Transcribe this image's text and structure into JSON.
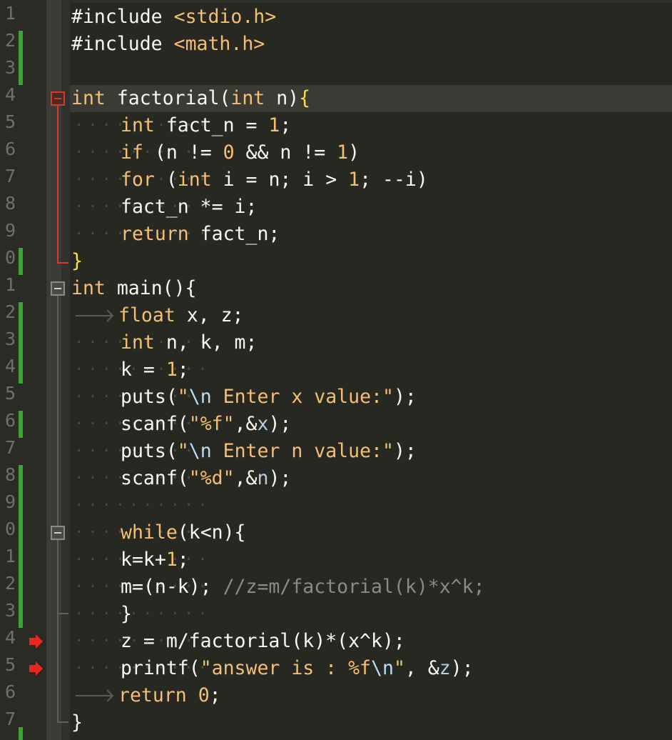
{
  "line_numbers": [
    "1",
    "2",
    "3",
    "4",
    "5",
    "6",
    "7",
    "8",
    "9",
    "0",
    "1",
    "2",
    "3",
    "4",
    "5",
    "6",
    "7",
    "8",
    "9",
    "0",
    "1",
    "2",
    "3",
    "4",
    "5",
    "6",
    "7"
  ],
  "colors": {
    "background": "#272822",
    "keyword": "#f4bf75",
    "comment": "#8b8b85",
    "bracket": "#f8e049",
    "git_modified": "#3f9f3a",
    "breakpoint": "#e8281e"
  },
  "code": {
    "l1": {
      "a": "#include",
      "b": " ",
      "c": "<stdio.h>"
    },
    "l2": {
      "a": "#include",
      "b": " ",
      "c": "<math.h>"
    },
    "l4": {
      "t1": "int",
      "s1": " factorial(",
      "t2": "int",
      "s2": " n)",
      "br": "{"
    },
    "l5": {
      "t1": "int",
      "s1": " fact_n = ",
      "n1": "1",
      "s2": ";"
    },
    "l6": {
      "k1": "if",
      "s1": " (n != ",
      "n1": "0",
      "s2": " && n != ",
      "n2": "1",
      "s3": ")"
    },
    "l7": {
      "k1": "for",
      "s1": " (",
      "t1": "int",
      "s2": " i = n; i > ",
      "n1": "1",
      "s3": "; --i)"
    },
    "l8": {
      "s1": "fact_n *= i;"
    },
    "l9": {
      "k1": "return",
      "s1": " fact_n;"
    },
    "l10": {
      "br": "}"
    },
    "l11": {
      "t1": "int",
      "s1": " main(){"
    },
    "l12": {
      "t1": "float",
      "s1": " x, z;"
    },
    "l13": {
      "t1": "int",
      "s1": " n, k, m;"
    },
    "l14": {
      "s1": "k = ",
      "n1": "1",
      "s2": ";"
    },
    "l15": {
      "s1": "puts(",
      "q1": "\"",
      "e1": "\\n",
      "q2": " Enter x value:\"",
      "s2": ");"
    },
    "l16": {
      "s1": "scanf(",
      "q1": "\"%f\"",
      "s2": ",&",
      "v1": "x",
      "s3": ");"
    },
    "l17": {
      "s1": "puts(",
      "q1": "\"",
      "e1": "\\n",
      "q2": " Enter n value:\"",
      "s2": ");"
    },
    "l18": {
      "s1": "scanf(",
      "q1": "\"%d\"",
      "s2": ",&",
      "v1": "n",
      "s3": ");"
    },
    "l20": {
      "k1": "while",
      "s1": "(k<n){"
    },
    "l21": {
      "s1": "k=k+",
      "n1": "1",
      "s2": ";"
    },
    "l22": {
      "s1": "m=(n-k); ",
      "c1": "//z=m/factorial(k)*x^k;"
    },
    "l23": {
      "s1": "}"
    },
    "l24": {
      "s1": "z = m/factorial(k)*(x^k);"
    },
    "l25": {
      "s1": "printf(",
      "q1": "\"answer is : %f",
      "e1": "\\n",
      "q2": "\"",
      "s2": ", &",
      "v1": "z",
      "s3": ");"
    },
    "l26": {
      "k1": "return",
      "s1": " ",
      "n1": "0",
      "s2": ";"
    },
    "l27": {
      "s1": "}"
    }
  }
}
